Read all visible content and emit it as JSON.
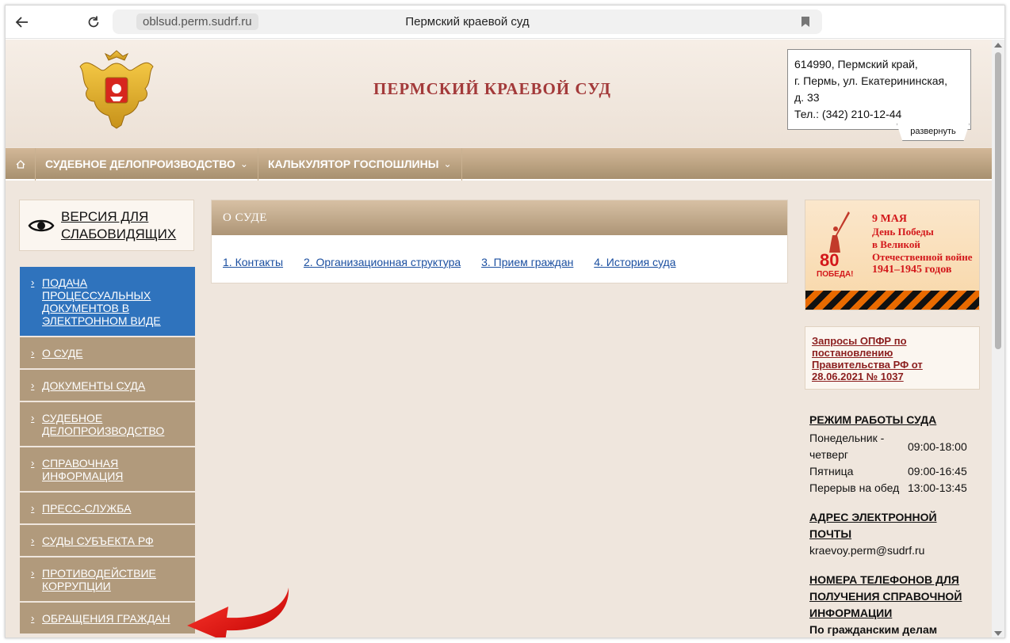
{
  "browser": {
    "domain": "oblsud.perm.sudrf.ru",
    "page_title": "Пермский краевой суд"
  },
  "header": {
    "site_title": "ПЕРМСКИЙ КРАЕВОЙ СУД",
    "address": {
      "line1": "614990, Пермский край,",
      "line2": "г. Пермь, ул. Екатерининская,",
      "line3": "д. 33",
      "phone": "Тел.: (342) 210-12-44",
      "expand_label": "развернуть"
    }
  },
  "nav": {
    "items": [
      {
        "label": "СУДЕБНОЕ ДЕЛОПРОИЗВОДСТВО"
      },
      {
        "label": "КАЛЬКУЛЯТОР ГОСПОШЛИНЫ"
      }
    ]
  },
  "accessibility": {
    "label_line1": "ВЕРСИЯ ДЛЯ",
    "label_line2": "СЛАБОВИДЯЩИХ"
  },
  "sidebar": {
    "items": [
      {
        "lines": [
          "ПОДАЧА",
          "ПРОЦЕССУАЛЬНЫХ",
          "ДОКУМЕНТОВ В",
          "ЭЛЕКТРОННОМ ВИДЕ"
        ]
      },
      {
        "lines": [
          "О СУДЕ"
        ]
      },
      {
        "lines": [
          "ДОКУМЕНТЫ СУДА"
        ]
      },
      {
        "lines": [
          "СУДЕБНОЕ",
          "ДЕЛОПРОИЗВОДСТВО"
        ]
      },
      {
        "lines": [
          "СПРАВОЧНАЯ",
          "ИНФОРМАЦИЯ"
        ]
      },
      {
        "lines": [
          "ПРЕСС-СЛУЖБА"
        ]
      },
      {
        "lines": [
          "СУДЫ СУБЪЕКТА РФ"
        ]
      },
      {
        "lines": [
          "ПРОТИВОДЕЙСТВИЕ",
          "КОРРУПЦИИ"
        ]
      },
      {
        "lines": [
          "ОБРАЩЕНИЯ ГРАЖДАН"
        ]
      }
    ]
  },
  "main": {
    "section_title": "О СУДЕ",
    "links": [
      "1. Контакты",
      "2. Организационная структура",
      "3. Прием граждан",
      "4. История суда"
    ]
  },
  "banner": {
    "line1": "9 МАЯ",
    "line2": "День Победы",
    "line3": "в Великой",
    "line4": "Отечественной войне",
    "line5": "1941–1945 годов",
    "number": "80",
    "pobeda": "ПОБЕДА!"
  },
  "opfr": {
    "text": "Запросы ОПФР по постановлению Правительства РФ от 28.06.2021 № 1037"
  },
  "info": {
    "schedule_title": "РЕЖИМ РАБОТЫ СУДА",
    "schedule": [
      {
        "day": "Понедельник - четверг",
        "time": "09:00-18:00"
      },
      {
        "day": "Пятница",
        "time": "09:00-16:45"
      },
      {
        "day": "Перерыв на обед",
        "time": "13:00-13:45"
      }
    ],
    "email_title": "АДРЕС ЭЛЕКТРОННОЙ ПОЧТЫ",
    "email": "kraevoy.perm@sudrf.ru",
    "phones_title": "НОМЕРА ТЕЛЕФОНОВ ДЛЯ ПОЛУЧЕНИЯ СПРАВОЧНОЙ ИНФОРМАЦИИ",
    "phones_sub": "По гражданским делам"
  },
  "colors": {
    "nav_brown": "#a7906f",
    "menu_brown": "#b19a7c",
    "menu_active": "#2f73bd",
    "title_red": "#a33a3a",
    "page_bg": "#efe6dd"
  }
}
